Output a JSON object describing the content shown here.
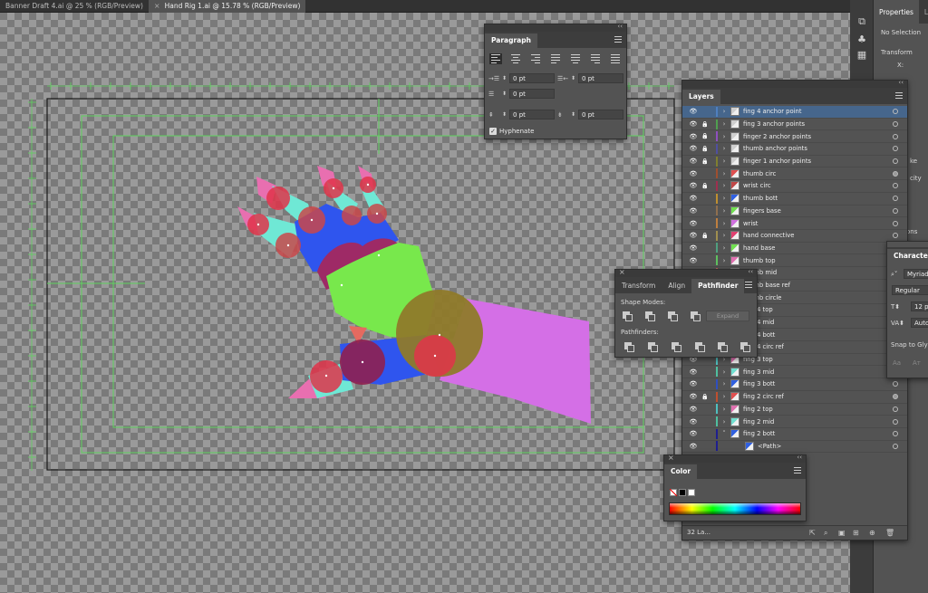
{
  "doc_tabs": [
    {
      "label": "Banner Draft 4.ai @ 25 % (RGB/Preview)",
      "active": false
    },
    {
      "label": "Hand Rig 1.ai @ 15.78 % (RGB/Preview)",
      "active": true
    }
  ],
  "close_glyph": "×",
  "properties": {
    "tabs": [
      "Properties",
      "Li"
    ],
    "no_selection": "No Selection",
    "transform": "Transform",
    "x_label": "X:",
    "partial": [
      "ke",
      "city",
      "ons"
    ]
  },
  "paragraph": {
    "title": "Paragraph",
    "left_indent": "0 pt",
    "right_indent": "0 pt",
    "first_line_indent": "0 pt",
    "space_before": "0 pt",
    "space_after": "0 pt",
    "hyphenate": "Hyphenate"
  },
  "layers": {
    "title": "Layers",
    "count": "32 La...",
    "rows": [
      {
        "name": "fing 4 anchor point",
        "color": "#4f7fbf",
        "thumb": "#cfcfcf",
        "locked": false,
        "selected": true,
        "target_filled": false
      },
      {
        "name": "fing 3 anchor points",
        "color": "#4f9f4f",
        "thumb": "#cfcfcf",
        "locked": true,
        "selected": false,
        "target_filled": false
      },
      {
        "name": "finger 2 anchor points",
        "color": "#8f4fbf",
        "thumb": "#cfcfcf",
        "locked": true,
        "selected": false,
        "target_filled": false
      },
      {
        "name": "thumb anchor points",
        "color": "#4f4f9f",
        "thumb": "#cfcfcf",
        "locked": true,
        "selected": false,
        "target_filled": false
      },
      {
        "name": "finger 1 anchor points",
        "color": "#7f7f2f",
        "thumb": "#cfcfcf",
        "locked": true,
        "selected": false,
        "target_filled": false
      },
      {
        "name": "thumb circ",
        "color": "#9f4f2f",
        "thumb": "#e05050",
        "locked": false,
        "selected": false,
        "target_filled": true
      },
      {
        "name": "wrist circ",
        "color": "#9f2f4f",
        "thumb": "#c04848",
        "locked": true,
        "selected": false,
        "target_filled": false
      },
      {
        "name": "thumb bott",
        "color": "#bf8f2f",
        "thumb": "#3060e0",
        "locked": false,
        "selected": false,
        "target_filled": false
      },
      {
        "name": "fingers base",
        "color": "#8f6f4f",
        "thumb": "#70e050",
        "locked": false,
        "selected": false,
        "target_filled": false
      },
      {
        "name": "wrist",
        "color": "#bf7f3f",
        "thumb": "#d070e0",
        "locked": false,
        "selected": false,
        "target_filled": false
      },
      {
        "name": "hand connective",
        "color": "#9f8f4f",
        "thumb": "#e04070",
        "locked": true,
        "selected": false,
        "target_filled": false
      },
      {
        "name": "hand base",
        "color": "#4f9f7f",
        "thumb": "#70e050",
        "locked": false,
        "selected": false,
        "target_filled": false
      },
      {
        "name": "thumb top",
        "color": "#5fbf5f",
        "thumb": "#e070b0",
        "locked": false,
        "selected": false,
        "target_filled": false
      },
      {
        "name": "thumb mid",
        "color": "#bf5f5f",
        "thumb": "#70e0d0",
        "locked": false,
        "selected": false,
        "target_filled": false
      },
      {
        "name": "thumb base ref",
        "color": "#5f5fbf",
        "thumb": "#3060e0",
        "locked": false,
        "selected": false,
        "target_filled": false
      },
      {
        "name": "thumb circle",
        "color": "#bf5fbf",
        "thumb": "#e05050",
        "locked": false,
        "selected": false,
        "target_filled": false
      },
      {
        "name": "fing 4 top",
        "color": "#5fbfbf",
        "thumb": "#e070b0",
        "locked": false,
        "selected": false,
        "target_filled": false
      },
      {
        "name": "fing 4 mid",
        "color": "#bfbf5f",
        "thumb": "#70e0d0",
        "locked": false,
        "selected": false,
        "target_filled": false
      },
      {
        "name": "fing 4 bott",
        "color": "#7f7fbf",
        "thumb": "#3060e0",
        "locked": false,
        "selected": false,
        "target_filled": false
      },
      {
        "name": "fing 4 circ ref",
        "color": "#bf7f7f",
        "thumb": "#e05050",
        "locked": false,
        "selected": false,
        "target_filled": false
      },
      {
        "name": "fing 3 top",
        "color": "#4fbfbf",
        "thumb": "#e070b0",
        "locked": false,
        "selected": false,
        "target_filled": false
      },
      {
        "name": "fing 3 mid",
        "color": "#4fbf9f",
        "thumb": "#70e0d0",
        "locked": false,
        "selected": false,
        "target_filled": false
      },
      {
        "name": "fing 3 bott",
        "color": "#2f4fbf",
        "thumb": "#3060e0",
        "locked": false,
        "selected": false,
        "target_filled": false
      },
      {
        "name": "fing 2 circ ref",
        "color": "#bf4f2f",
        "thumb": "#e05050",
        "locked": true,
        "selected": false,
        "target_filled": true
      },
      {
        "name": "fing 2 top",
        "color": "#4fbfbf",
        "thumb": "#e070b0",
        "locked": false,
        "selected": false,
        "target_filled": false
      },
      {
        "name": "fing 2 mid",
        "color": "#4fbf9f",
        "thumb": "#70e0d0",
        "locked": false,
        "selected": false,
        "target_filled": false
      },
      {
        "name": "fing 2 bott",
        "color": "#1f1f8f",
        "thumb": "#3060e0",
        "locked": false,
        "selected": false,
        "target_filled": false,
        "expanded": true
      },
      {
        "name": "<Path>",
        "color": "#1f1f8f",
        "thumb": "#3060e0",
        "locked": false,
        "selected": false,
        "target_filled": false,
        "child": true
      }
    ]
  },
  "pathfinder": {
    "tabs": [
      "Transform",
      "Align",
      "Pathfinder"
    ],
    "shape_modes": "Shape Modes:",
    "pathfinders": "Pathfinders:",
    "expand": "Expand"
  },
  "color_panel": {
    "title": "Color"
  },
  "character": {
    "title": "Character",
    "font": "Myriad",
    "style": "Regular",
    "size": "12 p",
    "tracking": "Auto",
    "snap": "Snap to Glyph"
  },
  "colors": {
    "pink": "#e86fb0",
    "teal": "#6fe8d5",
    "blue": "#2f55ee",
    "green": "#78e84c",
    "magenta": "#d46fe6",
    "red": "#e0344a",
    "olive": "#8f7a2a",
    "guide": "#5fd35f"
  }
}
